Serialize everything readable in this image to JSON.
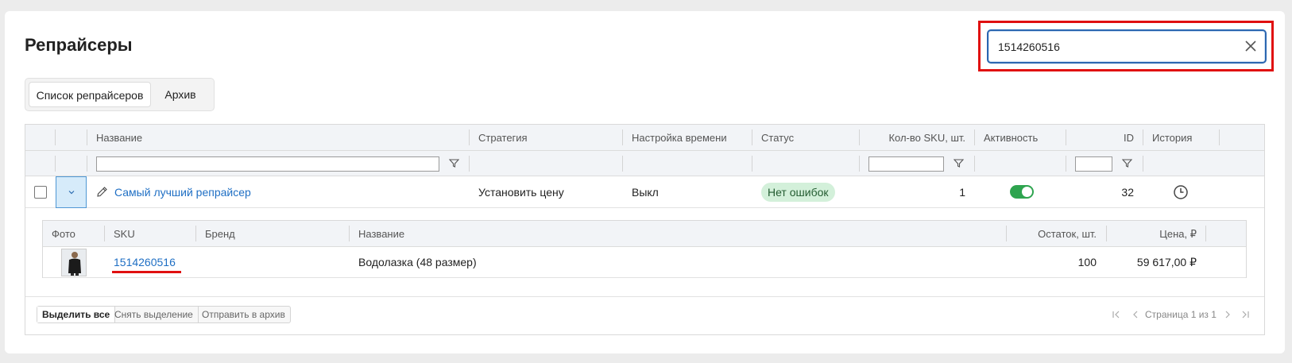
{
  "page": {
    "title": "Репрайсеры"
  },
  "search": {
    "value": "1514260516"
  },
  "tabs": [
    {
      "label": "Список репрайсеров",
      "active": true
    },
    {
      "label": "Архив",
      "active": false
    }
  ],
  "table": {
    "columns": {
      "name": "Название",
      "strategy": "Стратегия",
      "time_setting": "Настройка времени",
      "status": "Статус",
      "sku_count": "Кол-во SKU, шт.",
      "activity": "Активность",
      "id": "ID",
      "history": "История"
    },
    "rows": [
      {
        "name": "Самый лучший репрайсер",
        "strategy": "Установить цену",
        "time_setting": "Выкл",
        "status": "Нет ошибок",
        "sku_count": "1",
        "active": true,
        "id": "32"
      }
    ]
  },
  "detail": {
    "columns": {
      "photo": "Фото",
      "sku": "SKU",
      "brand": "Бренд",
      "name": "Название",
      "stock": "Остаток, шт.",
      "price": "Цена, ₽"
    },
    "rows": [
      {
        "sku": "1514260516",
        "brand": "",
        "name": "Водолазка (48 размер)",
        "stock": "100",
        "price": "59 617,00 ₽"
      }
    ]
  },
  "footer": {
    "select_all": "Выделить все",
    "deselect": "Снять выделение",
    "archive": "Отправить в архив",
    "page_info": "Страница 1 из 1"
  },
  "colors": {
    "accent": "#1f6fc4",
    "highlight": "#e01010",
    "toggle_on": "#2ea44f",
    "badge_bg": "#d3f0da"
  }
}
